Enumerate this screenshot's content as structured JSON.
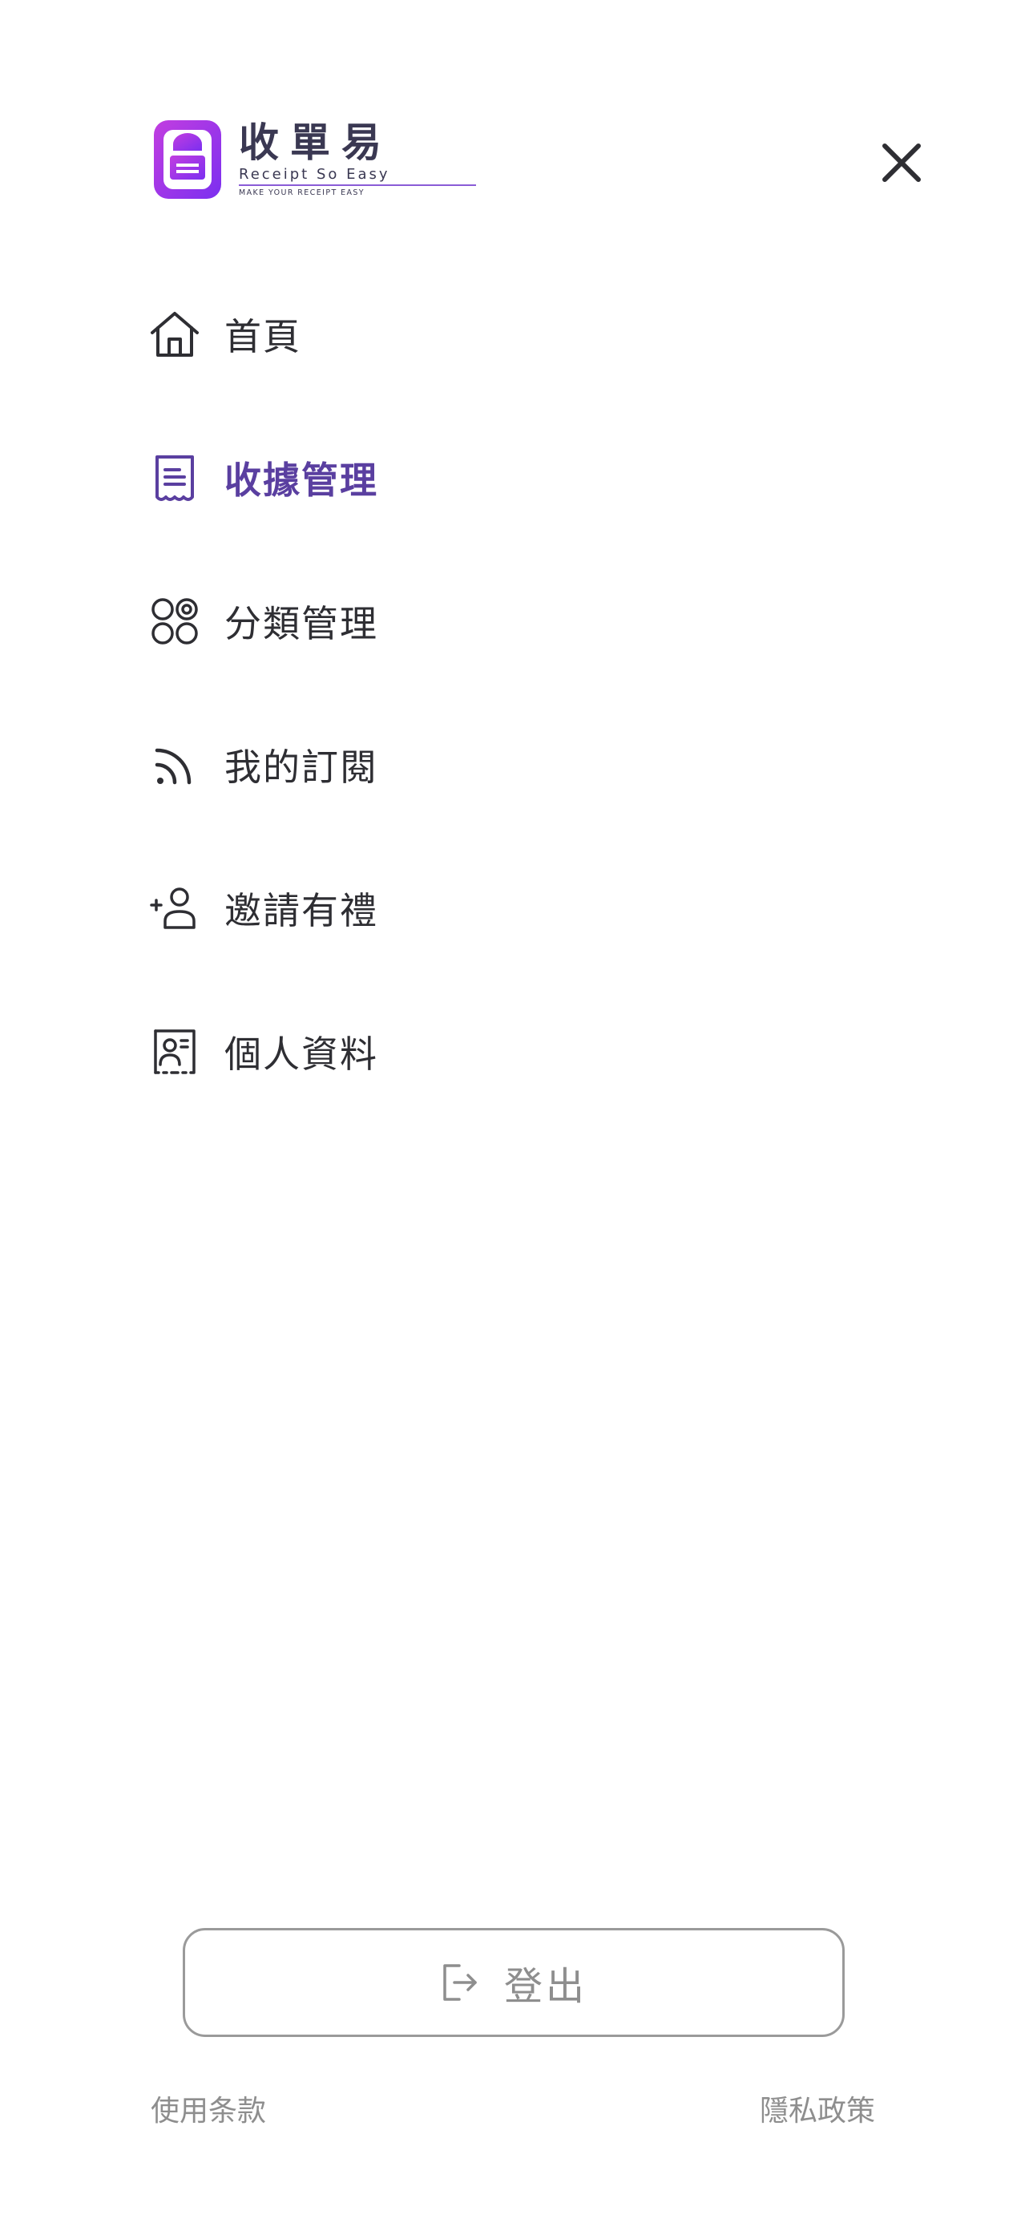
{
  "brand": {
    "title": "收單易",
    "subtitle": "Receipt So Easy",
    "tagline": "MAKE YOUR RECEIPT EASY",
    "accent_color": "#5a3fa0",
    "gradient_colors": [
      "#c23ee0",
      "#7b2ff0"
    ]
  },
  "menu": {
    "items": [
      {
        "label": "首頁",
        "icon": "home-icon",
        "active": false
      },
      {
        "label": "收據管理",
        "icon": "receipt-icon",
        "active": true
      },
      {
        "label": "分類管理",
        "icon": "categories-icon",
        "active": false
      },
      {
        "label": "我的訂閱",
        "icon": "subscription-icon",
        "active": false
      },
      {
        "label": "邀請有禮",
        "icon": "invite-icon",
        "active": false
      },
      {
        "label": "個人資料",
        "icon": "profile-icon",
        "active": false
      }
    ]
  },
  "logout": {
    "label": "登出",
    "icon": "logout-icon"
  },
  "footer": {
    "terms_label": "使用条款",
    "privacy_label": "隱私政策"
  }
}
